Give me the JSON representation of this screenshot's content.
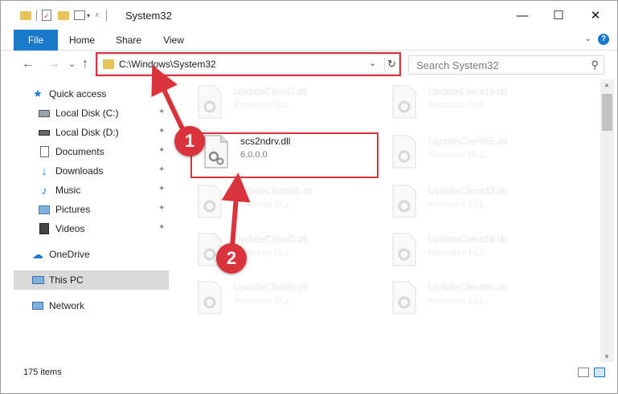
{
  "window": {
    "title": "System32",
    "minimize_glyph": "—",
    "maximize_glyph": "☐",
    "close_glyph": "✕"
  },
  "ribbon": {
    "tabs": [
      "File",
      "Home",
      "Share",
      "View"
    ],
    "help_glyph": "?",
    "expand_glyph": "⌄"
  },
  "address": {
    "path": "C:\\Windows\\System32",
    "dropdown_glyph": "⌄",
    "refresh_glyph": "↻"
  },
  "search": {
    "placeholder": "Search System32",
    "icon": "search-icon"
  },
  "nav_buttons": {
    "back": "←",
    "forward": "→",
    "recent": "⌄",
    "up": "↑"
  },
  "sidebar": {
    "items": [
      {
        "label": "Quick access",
        "icon": "star-icon",
        "pinned": false
      },
      {
        "label": "Local Disk (C:)",
        "icon": "drive-icon",
        "pinned": true
      },
      {
        "label": "Local Disk (D:)",
        "icon": "drive-icon",
        "pinned": true
      },
      {
        "label": "Documents",
        "icon": "documents-icon",
        "pinned": true
      },
      {
        "label": "Downloads",
        "icon": "downloads-icon",
        "pinned": true
      },
      {
        "label": "Music",
        "icon": "music-icon",
        "pinned": true
      },
      {
        "label": "Pictures",
        "icon": "pictures-icon",
        "pinned": true
      },
      {
        "label": "Videos",
        "icon": "videos-icon",
        "pinned": true
      },
      {
        "label": "OneDrive",
        "icon": "cloud-icon",
        "pinned": false
      },
      {
        "label": "This PC",
        "icon": "computer-icon",
        "pinned": false,
        "selected": true
      },
      {
        "label": "Network",
        "icon": "network-icon",
        "pinned": false
      }
    ],
    "pin_glyph": "📌"
  },
  "files": {
    "left": [
      {
        "name": "UpdateClient5.dll",
        "desc": "Resource DLL"
      },
      {
        "name": "scs2ndrv.dll",
        "desc": "6.0.0.0",
        "active": true
      },
      {
        "name": "UpdateClient65.dll",
        "desc": "Resource DLL"
      },
      {
        "name": "UpdateClient5.dll",
        "desc": "Resource DLL"
      },
      {
        "name": "UpdateClient5.dll",
        "desc": "Resource DLL"
      }
    ],
    "right": [
      {
        "name": "UpdateClient19.dll",
        "desc": "Resource DLL"
      },
      {
        "name": "UpdateClient65.dll",
        "desc": "Resource DLL"
      },
      {
        "name": "UpdateClient42.dll",
        "desc": "Resource DLL"
      },
      {
        "name": "UpdateClient19.dll",
        "desc": "Resource DLL"
      },
      {
        "name": "UpdateClient65.dll",
        "desc": "Resource DLL"
      }
    ]
  },
  "status": {
    "item_count": "175 items"
  },
  "annotations": {
    "step1": "1",
    "step2": "2",
    "color": "#d9333b"
  },
  "colors": {
    "accent": "#1979ca",
    "highlight": "#d9333b"
  }
}
